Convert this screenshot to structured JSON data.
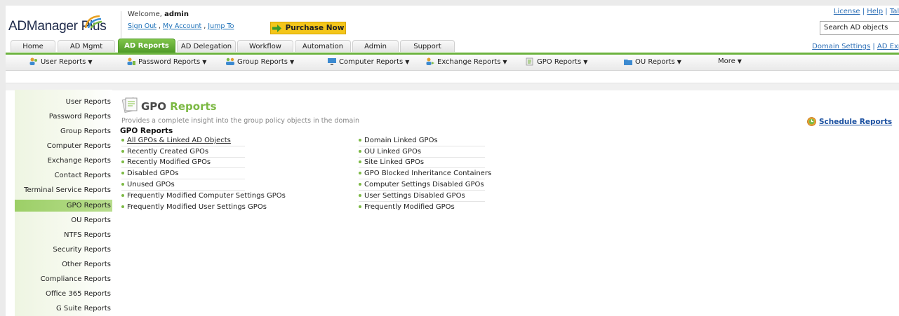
{
  "header": {
    "logo_text": "ADManager Plus",
    "welcome_prefix": "Welcome,",
    "user": "admin",
    "links": [
      "Sign Out",
      "My Account",
      "Jump To"
    ],
    "purchase_label": "Purchase Now",
    "top_links": [
      "License",
      "Help",
      "Talk"
    ],
    "search_placeholder": "Search AD objects",
    "domain_links": [
      "Domain Settings",
      "AD Expl"
    ]
  },
  "tabs": [
    {
      "label": "Home"
    },
    {
      "label": "AD Mgmt"
    },
    {
      "label": "AD Reports",
      "active": true
    },
    {
      "label": "AD Delegation"
    },
    {
      "label": "Workflow"
    },
    {
      "label": "Automation"
    },
    {
      "label": "Admin"
    },
    {
      "label": "Support"
    }
  ],
  "subnav": [
    {
      "label": "User Reports",
      "icon": "users-icon"
    },
    {
      "label": "Password Reports",
      "icon": "password-icon"
    },
    {
      "label": "Group Reports",
      "icon": "group-icon"
    },
    {
      "label": "Computer Reports",
      "icon": "computer-icon"
    },
    {
      "label": "Exchange Reports",
      "icon": "exchange-icon"
    },
    {
      "label": "GPO Reports",
      "icon": "gpo-icon"
    },
    {
      "label": "OU Reports",
      "icon": "ou-icon"
    },
    {
      "label": "More",
      "icon": ""
    }
  ],
  "sidebar": {
    "items": [
      "User Reports",
      "Password Reports",
      "Group Reports",
      "Computer Reports",
      "Exchange Reports",
      "Contact Reports",
      "Terminal Service Reports",
      "GPO Reports",
      "OU Reports",
      "NTFS Reports",
      "Security Reports",
      "Other Reports",
      "Compliance Reports",
      "Office 365 Reports",
      "G Suite Reports"
    ],
    "active": "GPO Reports"
  },
  "main": {
    "title_part1": "GPO",
    "title_part2": "Reports",
    "description": "Provides a complete insight into the group policy objects in the domain",
    "section_title": "GPO Reports",
    "left_links": [
      "All GPOs & Linked AD Objects",
      "Recently Created GPOs",
      "Recently Modified GPOs",
      "Disabled GPOs",
      "Unused GPOs",
      "Frequently Modified Computer Settings GPOs",
      "Frequently Modified User Settings GPOs"
    ],
    "right_links": [
      "Domain Linked GPOs",
      "OU Linked GPOs",
      "Site Linked GPOs",
      "GPO Blocked Inheritance Containers",
      "Computer Settings Disabled GPOs",
      "User Settings Disabled GPOs",
      "Frequently Modified GPOs"
    ],
    "schedule_label": "Schedule Reports"
  },
  "colors": {
    "accent_green": "#6cb33f",
    "purchase_yellow": "#f4c61a",
    "link_blue": "#1a4fa0"
  }
}
